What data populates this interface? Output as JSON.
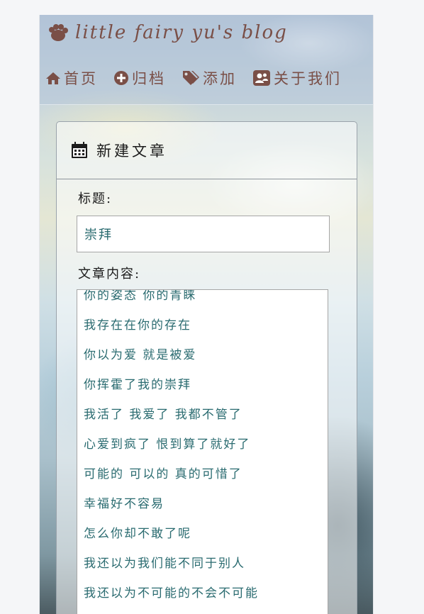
{
  "header": {
    "brand_title": "little fairy yu's blog",
    "brand_icon": "paw-icon",
    "nav": [
      {
        "label": "首页",
        "icon": "home-icon"
      },
      {
        "label": "归档",
        "icon": "plus-circle-icon"
      },
      {
        "label": "添加",
        "icon": "tags-icon"
      },
      {
        "label": "关于我们",
        "icon": "contact-card-icon"
      }
    ]
  },
  "panel": {
    "title": "新建文章",
    "title_icon": "calendar-icon",
    "title_field_label": "标题:",
    "title_value": "崇拜",
    "content_field_label": "文章内容:",
    "content_lines": [
      "你的姿态 你的青睐",
      "我存在在你的存在",
      "你以为爱 就是被爱",
      "你挥霍了我的崇拜",
      "我活了 我爱了 我都不管了",
      "心爱到疯了 恨到算了就好了",
      "可能的 可以的 真的可惜了",
      "幸福好不容易",
      "怎么你却不敢了呢",
      "我还以为我们能不同于别人",
      "我还以为不可能的不会不可能"
    ]
  },
  "colors": {
    "brand": "#7a4f47",
    "text_teal": "#2a6b70",
    "text_dark": "#1b1b1b"
  }
}
